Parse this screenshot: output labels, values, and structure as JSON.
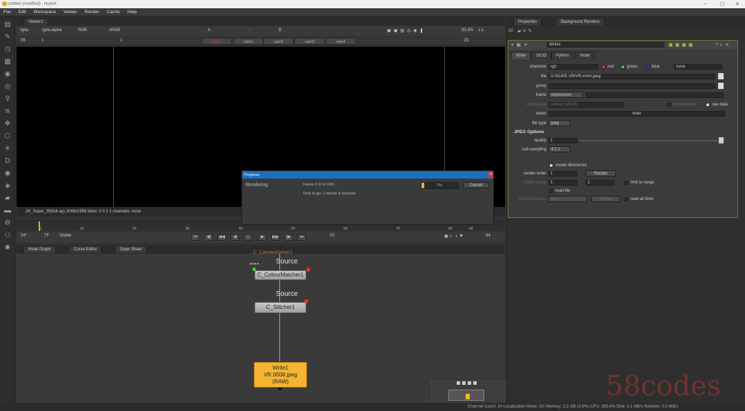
{
  "window": {
    "title": "untitled (modified) - NukeX",
    "minimize": "–",
    "maximize": "☐",
    "close": "✕"
  },
  "menu": [
    "File",
    "Edit",
    "Workspace",
    "Viewer",
    "Render",
    "Cache",
    "Help"
  ],
  "viewer": {
    "tab": "Viewer1",
    "channels": "rgba",
    "alpha": "rgba.alpha",
    "colorspace": "RGB",
    "display": "sRGB",
    "input_a": "A",
    "input_b": "B",
    "dash": "-",
    "frame": "1",
    "f_stop": "f/8",
    "proxy": "1",
    "zoom": "33.3%",
    "ratio": "1:1",
    "mode": "2D",
    "views": [
      "main",
      "cam1",
      "cam2",
      "cam3",
      "cam4"
    ],
    "info": "2K_Super_35(full-ap) 2048x1556  bbox: 0 0 1 1 channels: none"
  },
  "timeline": {
    "ticks": [
      "1",
      "10",
      "20",
      "30",
      "40",
      "50",
      "60",
      "70",
      "80",
      "90",
      "94"
    ],
    "start": "1",
    "fps": "24*",
    "tf": "TF",
    "visibility": "Visible",
    "current_frame": "1",
    "increment": "10",
    "end": "94",
    "controls": [
      "⏮",
      "◀|",
      "◀◀",
      "◀",
      "▶",
      "▶▶",
      "|▶",
      "⏭"
    ]
  },
  "nodegraph_tabs": [
    "Node Graph",
    "Curve Editor",
    "Dope Sheet"
  ],
  "nodes": {
    "top_label": "C_CameraSolver1",
    "source1": "Source",
    "colour_matcher": "C_ColourMatcher1",
    "source2": "Source",
    "stitcher": "C_Stitcher1",
    "write_line1": "Write1",
    "write_line2": "VR.0008.jpeg",
    "write_line3": "(RAW)"
  },
  "properties": {
    "tabs": [
      "Properties",
      "Background Renders"
    ],
    "count": "10",
    "node_name": "Write1",
    "subtabs": [
      "Write",
      "OCIO",
      "Python",
      "Node"
    ],
    "channels_label": "channels",
    "channels_value": "rgb",
    "red": "red",
    "green": "green",
    "blue": "blue",
    "extra_channel": "none",
    "file_label": "file",
    "file_value": "D:/NUKE-VR/VR.####.jpeg",
    "proxy_label": "proxy",
    "frame_label": "frame",
    "frame_value": "expression",
    "colorspace_label": "colorspace",
    "colorspace_value": "default (sRGB)",
    "premult_label": "premultiplied",
    "rawdata_label": "raw data",
    "views_label": "views",
    "views_value": "main",
    "filetype_label": "file type",
    "filetype_value": "jpeg",
    "section": "JPEG Options",
    "quality_label": "quality",
    "quality_value": "1",
    "subsampling_label": "sub-sampling",
    "subsampling_value": "4:1:1",
    "create_dirs": "create directories",
    "render_order_label": "render order",
    "render_order_value": "1",
    "render_button": "Render",
    "frame_range_label": "frame range",
    "frame_range_start": "1",
    "frame_range_end": "1",
    "limit_range": "limit to range",
    "read_file": "read file",
    "missing_frames_label": "missing frames",
    "missing_frames_value": "error",
    "reload": "Reload",
    "read_all_lines": "read all lines"
  },
  "progress": {
    "title": "Progress",
    "task": "Rendering",
    "frame_status": "Frame 0 (0 of 100)",
    "time_to_go": "Time to go: 1 minute 6 seconds",
    "percent_text": "7%",
    "percent": 7,
    "cancel": "Cancel"
  },
  "status": {
    "text": "Channel Count: 24  Localization Mode: On  Memory: 2.5 GB (3.9%)  CPU: 285.4%  Disk: 0.1 MB/s  Network: 0.0 MB/s"
  },
  "watermark": "58codes",
  "colors": {
    "accent": "#f0a830",
    "write_node": "#f5b532",
    "panel_border": "#6d7b2d",
    "progress_title": "#1f6fc0"
  }
}
